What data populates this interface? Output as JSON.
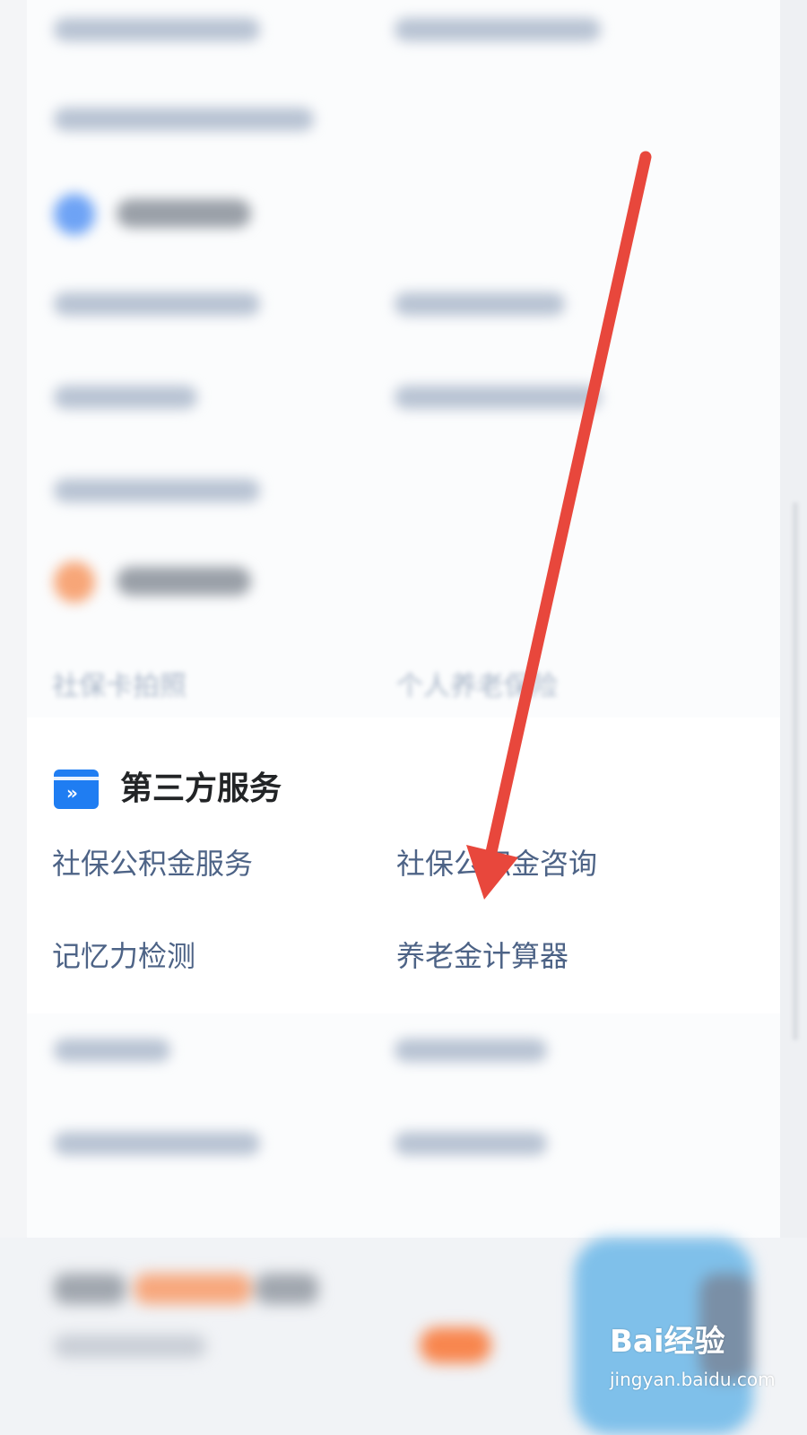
{
  "section": {
    "title": "第三方服务",
    "icon": "forward-chevrons-icon",
    "accent_color": "#1f7df2",
    "items": [
      {
        "label": "社保公积金服务"
      },
      {
        "label": "社保公积金咨询"
      },
      {
        "label": "记忆力检测"
      },
      {
        "label": "养老金计算器"
      }
    ]
  },
  "faded_previous_row": {
    "left": "社保卡拍照",
    "right": "个人养老保险"
  },
  "annotation": {
    "color": "#e8473c",
    "icon": "red-arrow-pointer"
  },
  "watermark": {
    "brand": "Bai经验",
    "url": "jingyan.baidu.com"
  }
}
